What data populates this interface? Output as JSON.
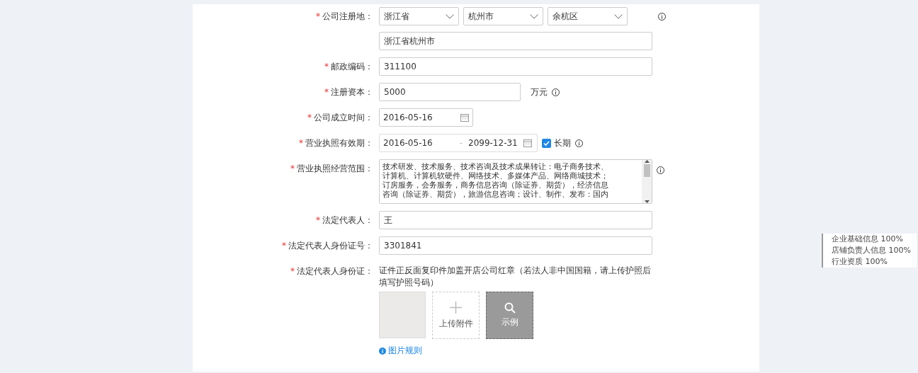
{
  "form": {
    "rows": [
      {
        "kind": "region",
        "marker": "*",
        "label": "公司注册地：",
        "selects": [
          "浙江省",
          "杭州市",
          "余杭区"
        ],
        "info": true,
        "address": "浙江省杭州市"
      },
      {
        "kind": "text",
        "marker": "*",
        "label": "邮政编码：",
        "value": "311100"
      },
      {
        "kind": "text-unit",
        "marker": "*",
        "label": "注册资本：",
        "value": "5000",
        "unit": "万元",
        "info": true
      },
      {
        "kind": "date",
        "marker": "*",
        "label": "公司成立时间：",
        "value": "2016-05-16"
      },
      {
        "kind": "range",
        "marker": "*",
        "label": "营业执照有效期：",
        "start": "2016-05-16",
        "separator": "-",
        "end": "2099-12-31",
        "checkbox": {
          "label": "长期",
          "checked": true
        },
        "info": true
      },
      {
        "kind": "textarea",
        "marker": "*",
        "label": "营业执照经营范围：",
        "lines": [
          "技术研发、技术服务、技术咨询及技术成果转让：电子商务技术、",
          "计算机、计算机软硬件、网络技术、多媒体产品、网络商城技术；",
          "订房服务，会务服务，商务信息咨询（除证券、期货），经济信息",
          "咨询（除证券、期货），旅游信息咨询；设计、制作、发布：国内"
        ],
        "info": true
      },
      {
        "kind": "text",
        "marker": "*",
        "label": "法定代表人：",
        "value": "王"
      },
      {
        "kind": "text",
        "marker": "*",
        "label": "法定代表人身份证号：",
        "value": "3301841"
      },
      {
        "kind": "upload",
        "marker": "*",
        "label": "法定代表人身份证：",
        "hint": "证件正反面复印件加盖开店公司红章（若法人非中国国籍，请上传护照后填写护照号码）",
        "upload_label": "上传附件",
        "example_label": "示例",
        "rules_link": "图片规则"
      }
    ]
  },
  "progress": [
    "企业基础信息 100%",
    "店铺负责人信息 100%",
    "行业资质 100%"
  ]
}
